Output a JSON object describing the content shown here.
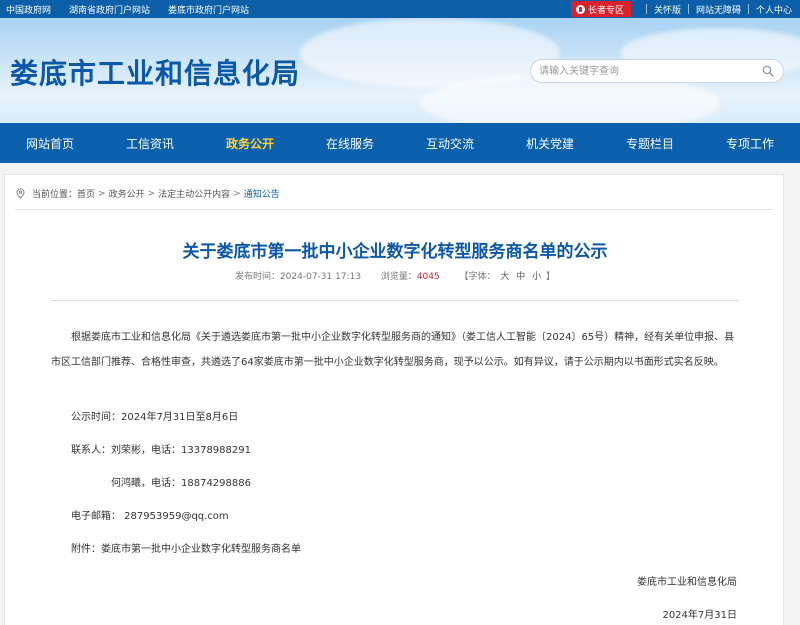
{
  "topbar": {
    "links": [
      "中国政府网",
      "湖南省政府门户网站",
      "娄底市政府门户网站"
    ],
    "elder_label": "长者专区",
    "right_links": [
      "关怀版",
      "网站无障碍",
      "个人中心"
    ]
  },
  "header": {
    "site_title": "娄底市工业和信息化局",
    "search_placeholder": "请输入关键字查询"
  },
  "nav": {
    "items": [
      "网站首页",
      "工信资讯",
      "政务公开",
      "在线服务",
      "互动交流",
      "机关党建",
      "专题栏目",
      "专项工作"
    ],
    "active_index": 2
  },
  "breadcrumb": {
    "prefix": "当前位置：",
    "items": [
      "首页",
      "政务公开",
      "法定主动公开内容",
      "通知公告"
    ],
    "separator": ">"
  },
  "article": {
    "title": "关于娄底市第一批中小企业数字化转型服务商名单的公示",
    "publish_label": "发布时间：",
    "publish_time": "2024-07-31 17:13",
    "views_label": "浏览量：",
    "views": "4045",
    "font_label": "【字体：",
    "font_sizes": [
      "大",
      "中",
      "小"
    ],
    "font_close": "】",
    "paragraph": "根据娄底市工业和信息化局《关于遴选娄底市第一批中小企业数字化转型服务商的通知》（娄工信人工智能〔2024〕65号）精神，经有关单位申报、县市区工信部门推荐、合格性审查，共遴选了64家娄底市第一批中小企业数字化转型服务商，现予以公示。如有异议，请于公示期内以书面形式实名反映。",
    "period": "公示时间：2024年7月31日至8月6日",
    "contact1": "联系人：刘荣彬，电话：13378988291",
    "contact2": "何鸿曦，电话：18874298886",
    "email": "电子邮箱：  287953959@qq.com",
    "attachment": "附件：娄底市第一批中小企业数字化转型服务商名单",
    "signature": "娄底市工业和信息化局",
    "date": "2024年7月31日"
  },
  "colors": {
    "primary_blue": "#0a60ad",
    "title_blue": "#0c58a8",
    "nav_active": "#ffd23c",
    "elder_red": "#d9232c",
    "views_red": "#c0282b"
  },
  "icons": [
    "elder-icon",
    "search-icon",
    "location-icon"
  ]
}
